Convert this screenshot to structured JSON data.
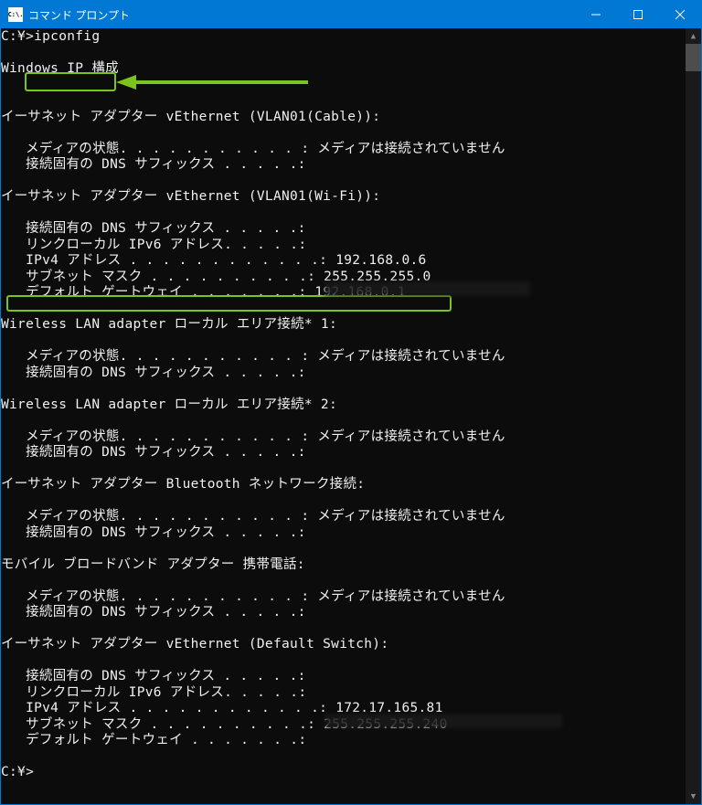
{
  "window": {
    "icon_text": "C:\\.",
    "title": "コマンド プロンプト"
  },
  "terminal": {
    "prompt1": "C:¥>",
    "command": "ipconfig",
    "header": "Windows IP 構成",
    "adapters": [
      {
        "title": "イーサネット アダプター vEthernet (VLAN01(Cable)):",
        "lines": [
          "   メディアの状態. . . . . . . . . . . : メディアは接続されていません",
          "   接続固有の DNS サフィックス . . . . .:"
        ]
      },
      {
        "title": "イーサネット アダプター vEthernet (VLAN01(Wi-Fi)):",
        "lines": [
          "   接続固有の DNS サフィックス . . . . .:",
          "   リンクローカル IPv6 アドレス. . . . .:",
          "   IPv4 アドレス . . . . . . . . . . . .: 192.168.0.6",
          "   サブネット マスク . . . . . . . . . .: 255.255.255.0",
          "   デフォルト ゲートウェイ . . . . . . .: 192.168.0.1"
        ]
      },
      {
        "title": "Wireless LAN adapter ローカル エリア接続* 1:",
        "lines": [
          "   メディアの状態. . . . . . . . . . . : メディアは接続されていません",
          "   接続固有の DNS サフィックス . . . . .:"
        ]
      },
      {
        "title": "Wireless LAN adapter ローカル エリア接続* 2:",
        "lines": [
          "   メディアの状態. . . . . . . . . . . : メディアは接続されていません",
          "   接続固有の DNS サフィックス . . . . .:"
        ]
      },
      {
        "title": "イーサネット アダプター Bluetooth ネットワーク接続:",
        "lines": [
          "   メディアの状態. . . . . . . . . . . : メディアは接続されていません",
          "   接続固有の DNS サフィックス . . . . .:"
        ]
      },
      {
        "title": "モバイル ブロードバンド アダプター 携帯電話:",
        "lines": [
          "   メディアの状態. . . . . . . . . . . : メディアは接続されていません",
          "   接続固有の DNS サフィックス . . . . .:"
        ]
      },
      {
        "title": "イーサネット アダプター vEthernet (Default Switch):",
        "lines": [
          "   接続固有の DNS サフィックス . . . . .:",
          "   リンクローカル IPv6 アドレス. . . . .:",
          "   IPv4 アドレス . . . . . . . . . . . .: 172.17.165.81",
          "   サブネット マスク . . . . . . . . . .: 255.255.255.240",
          "   デフォルト ゲートウェイ . . . . . . .:"
        ]
      }
    ],
    "prompt2": "C:¥>"
  }
}
